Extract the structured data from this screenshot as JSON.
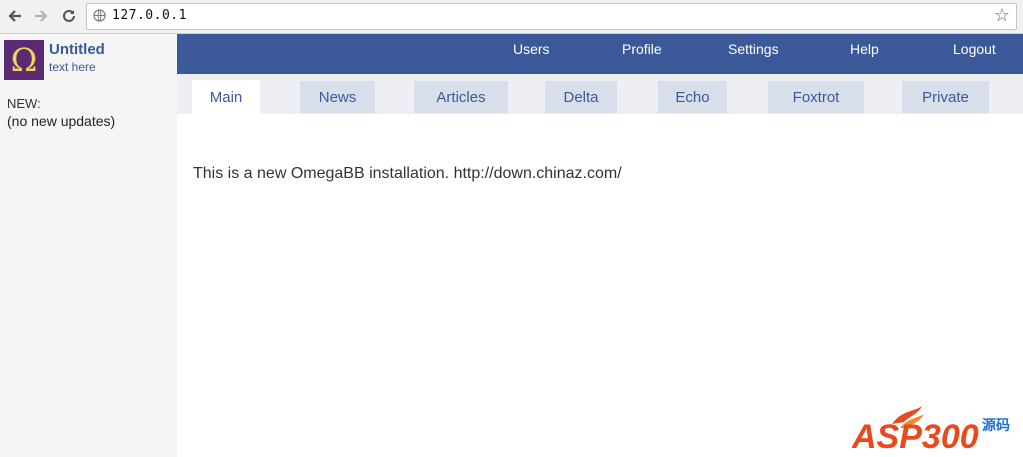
{
  "browser": {
    "back_icon": "arrow-left-icon",
    "forward_icon": "arrow-right-icon",
    "reload_icon": "reload-icon",
    "url": "127.0.0.1",
    "bookmark_icon": "star-icon"
  },
  "sidebar": {
    "logo_glyph": "Ω",
    "site_title": "Untitled",
    "site_subtitle": "text here",
    "updates_label": "NEW:",
    "updates_text": "(no new updates)"
  },
  "topnav": {
    "items": [
      {
        "label": "Users"
      },
      {
        "label": "Profile"
      },
      {
        "label": "Settings"
      },
      {
        "label": "Help"
      },
      {
        "label": "Logout"
      }
    ]
  },
  "tabs": [
    {
      "label": "Main",
      "active": true
    },
    {
      "label": "News"
    },
    {
      "label": "Articles"
    },
    {
      "label": "Delta"
    },
    {
      "label": "Echo"
    },
    {
      "label": "Foxtrot"
    },
    {
      "label": "Private"
    }
  ],
  "main": {
    "message": "This is a new OmegaBB installation. http://down.chinaz.com/"
  },
  "watermark": {
    "text": "ASP300",
    "suffix": "源码"
  },
  "colors": {
    "nav_blue": "#3b5998",
    "tab_bg": "#d8dfea",
    "logo_bg": "#5a2a72",
    "logo_fg": "#f2d45a",
    "watermark_red": "#e8491d",
    "watermark_blue": "#1f6fd6"
  }
}
